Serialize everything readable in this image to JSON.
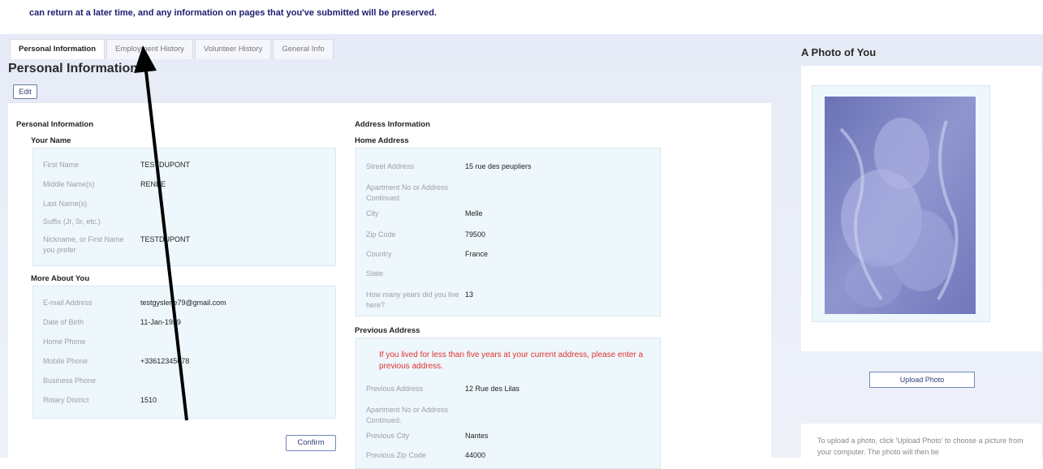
{
  "notice": {
    "text": "can return at a later time, and any information on pages that you've submitted will be preserved."
  },
  "tabs": [
    {
      "label": "Personal Information"
    },
    {
      "label": "Employment History"
    },
    {
      "label": "Volunteer History"
    },
    {
      "label": "General Info"
    }
  ],
  "page_title": "Personal Information",
  "edit_label": "Edit",
  "personal": {
    "heading": "Personal Information",
    "your_name": {
      "heading": "Your Name",
      "fields": [
        {
          "label": "First Name",
          "value": "TESTDUPONT"
        },
        {
          "label": "Middle Name(s)",
          "value": "RENEE"
        },
        {
          "label": "Last Name(s)",
          "value": ""
        },
        {
          "label": "Suffix (Jr, Sr, etc.)",
          "value": ""
        },
        {
          "label": "Nickname, or First Name you prefer",
          "value": "TESTDUPONT"
        }
      ]
    },
    "more_about": {
      "heading": "More About You",
      "fields": [
        {
          "label": "E-mail Address",
          "value": "testgyslene79@gmail.com"
        },
        {
          "label": "Date of Birth",
          "value": "11-Jan-1959"
        },
        {
          "label": "Home Phone",
          "value": ""
        },
        {
          "label": "Mobile Phone",
          "value": "+33612345678"
        },
        {
          "label": "Business Phone",
          "value": ""
        },
        {
          "label": "Rotary District",
          "value": "1510"
        }
      ]
    }
  },
  "address": {
    "heading": "Address Information",
    "home": {
      "heading": "Home Address",
      "fields": [
        {
          "label": "Street Address",
          "value": "15 rue des peupliers"
        },
        {
          "label": "Apartment No or Address Continued",
          "value": ""
        },
        {
          "label": "City",
          "value": "Melle"
        },
        {
          "label": "Zip Code",
          "value": "79500"
        },
        {
          "label": "Country",
          "value": "France"
        },
        {
          "label": "State",
          "value": ""
        },
        {
          "label": "How many years did you live here?",
          "value": "13"
        }
      ]
    },
    "previous": {
      "heading": "Previous Address",
      "warning": "If you lived for less than five years at your current address, please enter a previous address.",
      "fields": [
        {
          "label": "Previous Address",
          "value": "12 Rue des Lilas"
        },
        {
          "label": "Apartment No or Address Continued.",
          "value": ""
        },
        {
          "label": "Previous City",
          "value": "Nantes"
        },
        {
          "label": "Previous Zip Code",
          "value": "44000"
        }
      ]
    }
  },
  "confirm_label": "Confirm",
  "photo": {
    "title": "A Photo of You",
    "upload_label": "Upload Photo",
    "help": "To upload a photo, click 'Upload Photo' to choose a picture from your computer. The photo will then be"
  },
  "colors": {
    "accent": "#2c3e7a",
    "warning": "#e03131",
    "field_bg": "#eef7fb"
  }
}
